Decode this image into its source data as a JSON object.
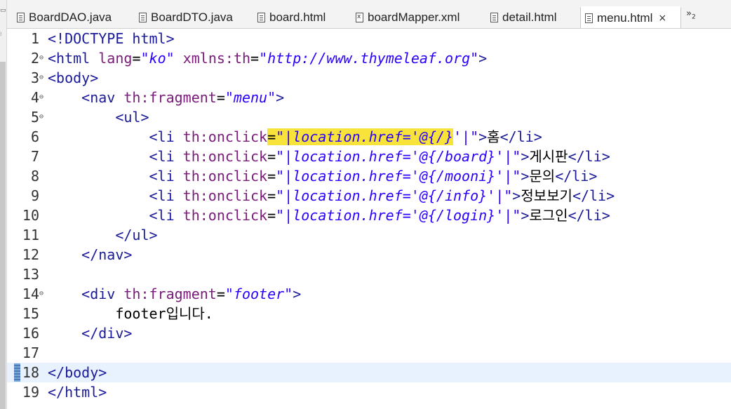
{
  "tabs": [
    {
      "label": "BoardDAO.java",
      "icon": "java-file-icon",
      "active": false
    },
    {
      "label": "BoardDTO.java",
      "icon": "java-file-icon",
      "active": false
    },
    {
      "label": "board.html",
      "icon": "html-file-icon",
      "active": false
    },
    {
      "label": "boardMapper.xml",
      "icon": "xml-file-icon",
      "active": false
    },
    {
      "label": "detail.html",
      "icon": "html-file-icon",
      "active": false
    },
    {
      "label": "menu.html",
      "icon": "html-file-icon",
      "active": true
    }
  ],
  "tab_overflow": {
    "label": "»",
    "count": "2"
  },
  "close_glyph": "×",
  "current_line": 18,
  "lines": [
    {
      "num": "1"
    },
    {
      "num": "2",
      "fold": "⊖"
    },
    {
      "num": "3",
      "fold": "⊖"
    },
    {
      "num": "4",
      "fold": "⊖"
    },
    {
      "num": "5",
      "fold": "⊖"
    },
    {
      "num": "6"
    },
    {
      "num": "7"
    },
    {
      "num": "8"
    },
    {
      "num": "9"
    },
    {
      "num": "10"
    },
    {
      "num": "11"
    },
    {
      "num": "12"
    },
    {
      "num": "13"
    },
    {
      "num": "14",
      "fold": "⊖"
    },
    {
      "num": "15"
    },
    {
      "num": "16"
    },
    {
      "num": "17"
    },
    {
      "num": "18"
    },
    {
      "num": "19"
    }
  ],
  "code": {
    "l1": "<!DOCTYPE html>",
    "l2_open": "<html",
    "l2_attr1": " lang",
    "l2_eq1": "=",
    "l2_val1": "\"ko\"",
    "l2_attr2": " xmlns:th",
    "l2_eq2": "=",
    "l2_val2": "\"http://www.thymeleaf.org\"",
    "l2_close": ">",
    "l3": "<body>",
    "l4_open": "    <nav",
    "l4_attr": " th:fragment",
    "l4_eq": "=",
    "l4_val": "\"menu\"",
    "l4_close": ">",
    "l5": "        <ul>",
    "li_open": "            <li",
    "li_attr": " th:onclick",
    "li_eq": "=",
    "l6_val_hl": "\"|location.href='@{/}",
    "l6_val_rest": "'|\"",
    "l6_text": "홈",
    "l7_val": "\"|location.href='@{/board}'|\"",
    "l7_text": "게시판",
    "l8_val": "\"|location.href='@{/mooni}'|\"",
    "l8_text": "문의",
    "l9_val": "\"|location.href='@{/info}'|\"",
    "l9_text": "정보보기",
    "l10_val": "\"|location.href='@{/login}'|\"",
    "l10_text": "로그인",
    "gt": ">",
    "li_close": "</li>",
    "l11": "        </ul>",
    "l12": "    </nav>",
    "l14_open": "    <div",
    "l14_attr": " th:fragment",
    "l14_eq": "=",
    "l14_val": "\"footer\"",
    "l14_close": ">",
    "l15": "        footer입니다.",
    "l16": "    </div>",
    "l18": "</body>",
    "l19": "</html>"
  },
  "colors": {
    "tag": "#1a1a9a",
    "attribute": "#7a1a7a",
    "value": "#2a00ff",
    "highlight": "#f7e33a",
    "current_line": "#e8f2fe"
  }
}
